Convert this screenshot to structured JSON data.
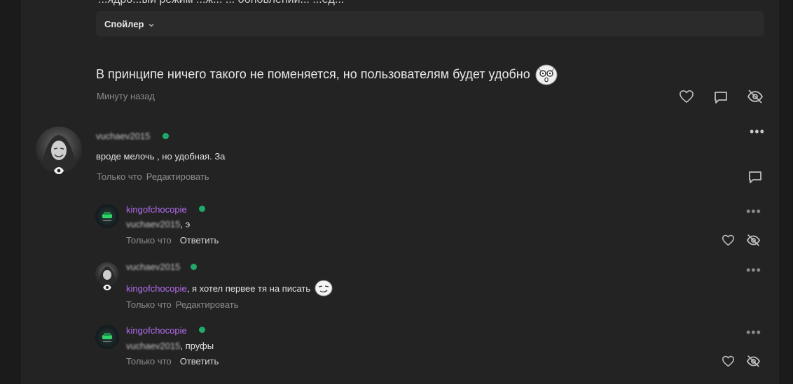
{
  "top": {
    "partial_text": "...ядро...ый режим ...ж... ... обновлений... ...ёд...",
    "spoiler_label": "Спойлер"
  },
  "main_comment": {
    "text": "В принципе ничего такого не поменяется, но пользователям будет удобно",
    "time": "Минуту назад"
  },
  "comments": [
    {
      "author": "vuchaev2015",
      "text": "вроде мелочь , но удобная. За",
      "time": "Только что",
      "action": "Редактировать"
    },
    {
      "author": "kingofchocopie",
      "mention": "vuchaev2015",
      "text": ", э",
      "time": "Только что",
      "action": "Ответить"
    },
    {
      "author": "vuchaev2015",
      "mention": "kingofchocopie",
      "text": ", я хотел первее тя на писать",
      "time": "Только что",
      "action": "Редактировать"
    },
    {
      "author": "kingofchocopie",
      "mention": "vuchaev2015",
      "text": ", пруфы",
      "time": "Только что",
      "action": "Ответить"
    }
  ],
  "icons": {
    "like": "heart-icon",
    "reply": "comment-bubble-icon",
    "hide": "eye-slash-icon",
    "more": "more-dots-icon",
    "spoiler_toggle": "chevron-down-icon"
  },
  "colors": {
    "background": "#1b1b1b",
    "panel": "#232323",
    "mention": "#b46cf0",
    "online": "#1faa6a"
  }
}
